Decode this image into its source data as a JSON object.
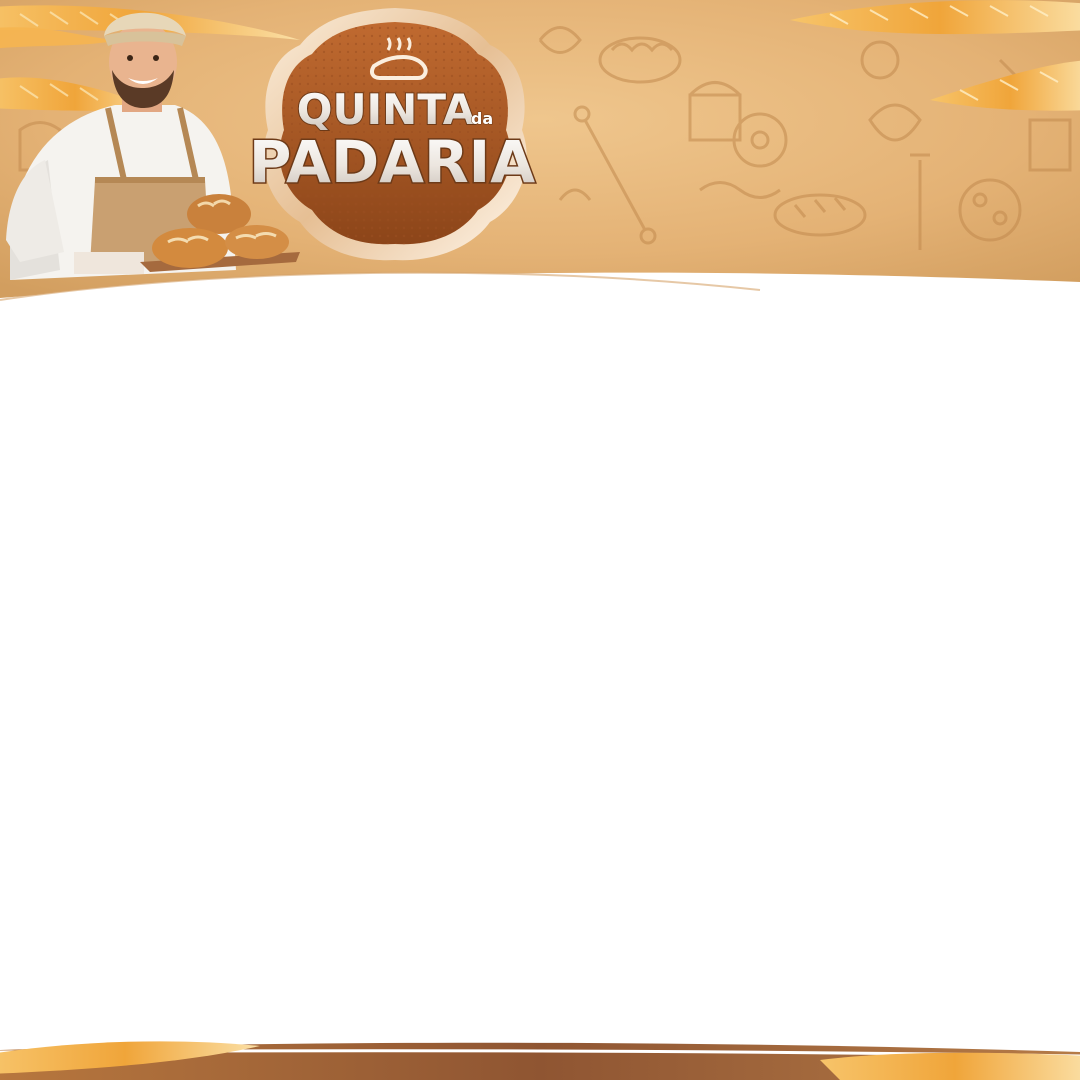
{
  "promo": {
    "title_line1": "QUINTA",
    "title_small": "da",
    "title_line2": "PADARIA"
  },
  "colors": {
    "background": "#ffffff",
    "kraft_paper": "#e8b97c",
    "kraft_dark": "#c98f4f",
    "wheat": "#f2a941",
    "badge_brown": "#b8642c",
    "badge_dark": "#7a3a12",
    "badge_rim": "#f3dcc0",
    "title_light": "#f4f1ee",
    "title_shadow": "#6d3a18",
    "apron": "#c9a071",
    "chef_coat": "#f5f3ef",
    "skin": "#e9b48f",
    "bread": "#d58a3c",
    "wood": "#8a5230"
  },
  "icons": [
    "chef-illustration",
    "bread-loaves-icon",
    "steaming-bread-icon",
    "wheat-stalk-icon"
  ]
}
